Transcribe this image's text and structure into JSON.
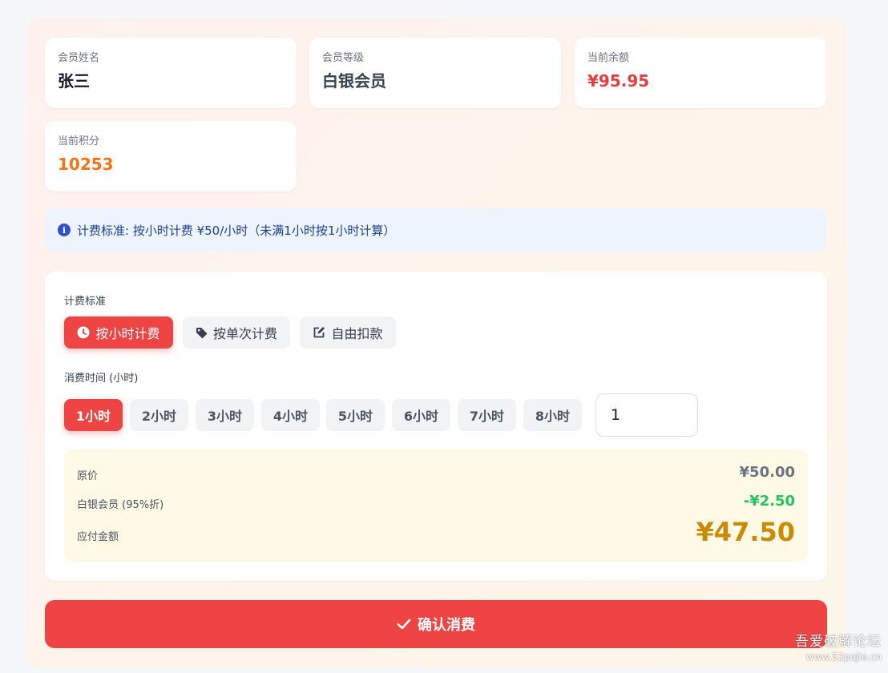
{
  "member": {
    "name_label": "会员姓名",
    "name": "张三",
    "level_label": "会员等级",
    "level": "白银会员",
    "balance_label": "当前余额",
    "balance": "¥95.95",
    "points_label": "当前积分",
    "points": "10253"
  },
  "notice": {
    "icon": "info-icon",
    "text": "计费标准: 按小时计费 ¥50/小时（未满1小时按1小时计算）"
  },
  "billing": {
    "label": "计费标准",
    "modes": [
      {
        "label": "按小时计费",
        "icon": "clock-icon",
        "active": true
      },
      {
        "label": "按单次计费",
        "icon": "tag-icon",
        "active": false
      },
      {
        "label": "自由扣款",
        "icon": "edit-icon",
        "active": false
      }
    ]
  },
  "duration": {
    "label": "消费时间 (小时)",
    "options": [
      "1小时",
      "2小时",
      "3小时",
      "4小时",
      "5小时",
      "6小时",
      "7小时",
      "8小时"
    ],
    "selected": "1小时",
    "input_value": "1"
  },
  "summary": {
    "original_label": "原价",
    "original_value": "¥50.00",
    "discount_label": "白银会员 (95%折)",
    "discount_value": "-¥2.50",
    "payable_label": "应付金额",
    "payable_value": "¥47.50"
  },
  "confirm": {
    "label": "确认消费",
    "icon": "check-icon"
  },
  "watermark": {
    "line1": "吾爱破解论坛",
    "line2": "www.52pojie.cn"
  },
  "colors": {
    "accent": "#ef4444",
    "balance": "#e53e3e",
    "points": "#f97316",
    "discount": "#22c55e",
    "payable": "#ca8a04",
    "notice_text": "#1d3f9a"
  }
}
